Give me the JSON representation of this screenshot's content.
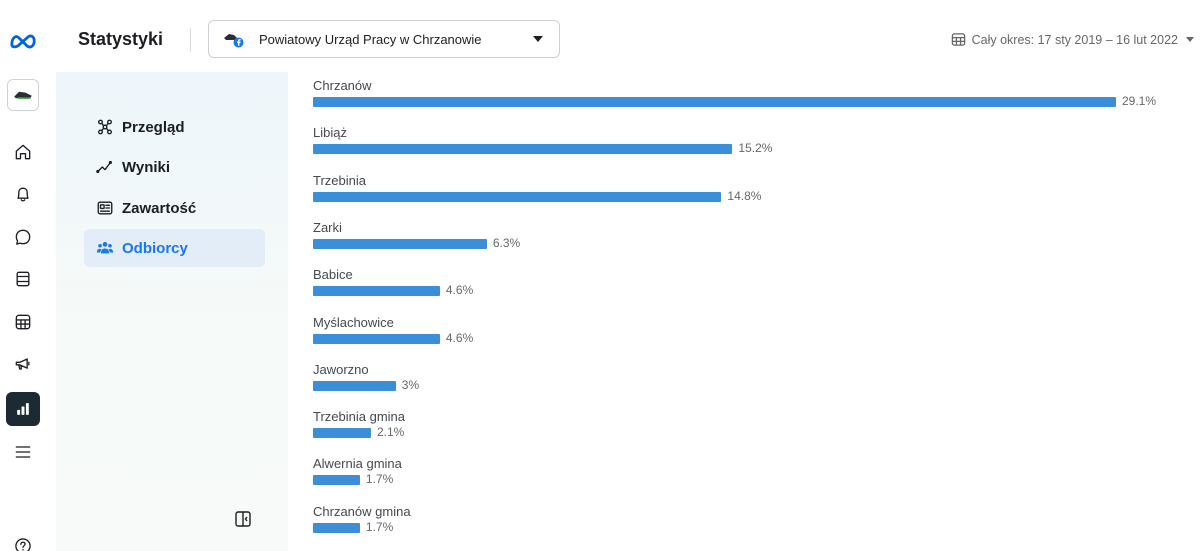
{
  "header": {
    "title": "Statystyki",
    "page_name": "Powiatowy Urząd Pracy w Chrzanowie",
    "date_range": "Cały okres: 17 sty 2019 – 16 lut 2022"
  },
  "rail": {
    "icons": [
      "meta-logo-icon",
      "page-avatar-icon",
      "home-icon",
      "notifications-bell-icon",
      "messages-icon",
      "content-icon",
      "planner-icon",
      "ads-megaphone-icon",
      "insights-icon",
      "menu-icon",
      "help-icon"
    ]
  },
  "nav": {
    "items": [
      {
        "label": "Przegląd",
        "icon": "overview-nodes-icon"
      },
      {
        "label": "Wyniki",
        "icon": "results-trend-icon"
      },
      {
        "label": "Zawartość",
        "icon": "content-card-icon"
      },
      {
        "label": "Odbiorcy",
        "icon": "audience-people-icon",
        "selected": true
      }
    ]
  },
  "colors": {
    "bar": "#3b8ed8",
    "accent": "#1877f2",
    "active_rail": "#1c2b33"
  },
  "chart_data": {
    "type": "bar",
    "orientation": "horizontal",
    "unit": "%",
    "categories": [
      "Chrzanów",
      "Libiąż",
      "Trzebinia",
      "Zarki",
      "Babice",
      "Myślachowice",
      "Jaworzno",
      "Trzebinia gmina",
      "Alwernia gmina",
      "Chrzanów gmina"
    ],
    "values": [
      29.1,
      15.2,
      14.8,
      6.3,
      4.6,
      4.6,
      3,
      2.1,
      1.7,
      1.7
    ],
    "value_labels": [
      "29.1%",
      "15.2%",
      "14.8%",
      "6.3%",
      "4.6%",
      "4.6%",
      "3%",
      "2.1%",
      "1.7%",
      "1.7%"
    ]
  }
}
